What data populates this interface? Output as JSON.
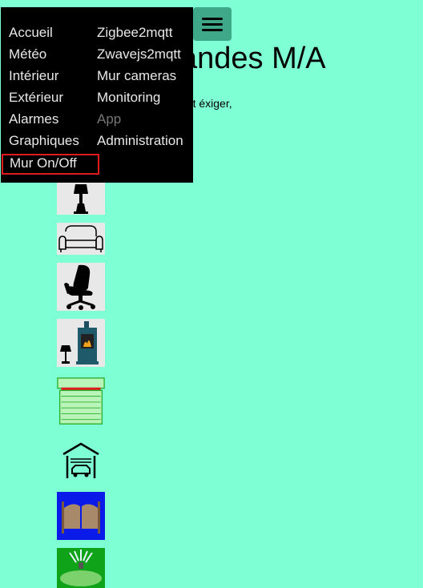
{
  "header": {
    "title": "andes M/A",
    "subtitle": "ent éxiger,"
  },
  "menu": {
    "left": [
      "Accueil",
      "Météo",
      "Intérieur",
      "Extérieur",
      "Alarmes",
      "Graphiques",
      "Mur On/Off"
    ],
    "right": [
      "Zigbee2mqtt",
      "Zwavejs2mqtt",
      "Mur cameras",
      "Monitoring",
      "App",
      "Administration"
    ],
    "active": "Mur On/Off",
    "disabled": "App"
  },
  "icons": [
    "lamp-icon",
    "sofa-icon",
    "office-chair-icon",
    "stove-lamp-icon",
    "roller-shutter-icon",
    "garage-icon",
    "gate-icon",
    "sprinkler-icon"
  ],
  "colors": {
    "background": "#7fffd4",
    "menu_bg": "#000000",
    "active_border": "#e01b1b",
    "hamburger_bg": "#3fa889"
  }
}
